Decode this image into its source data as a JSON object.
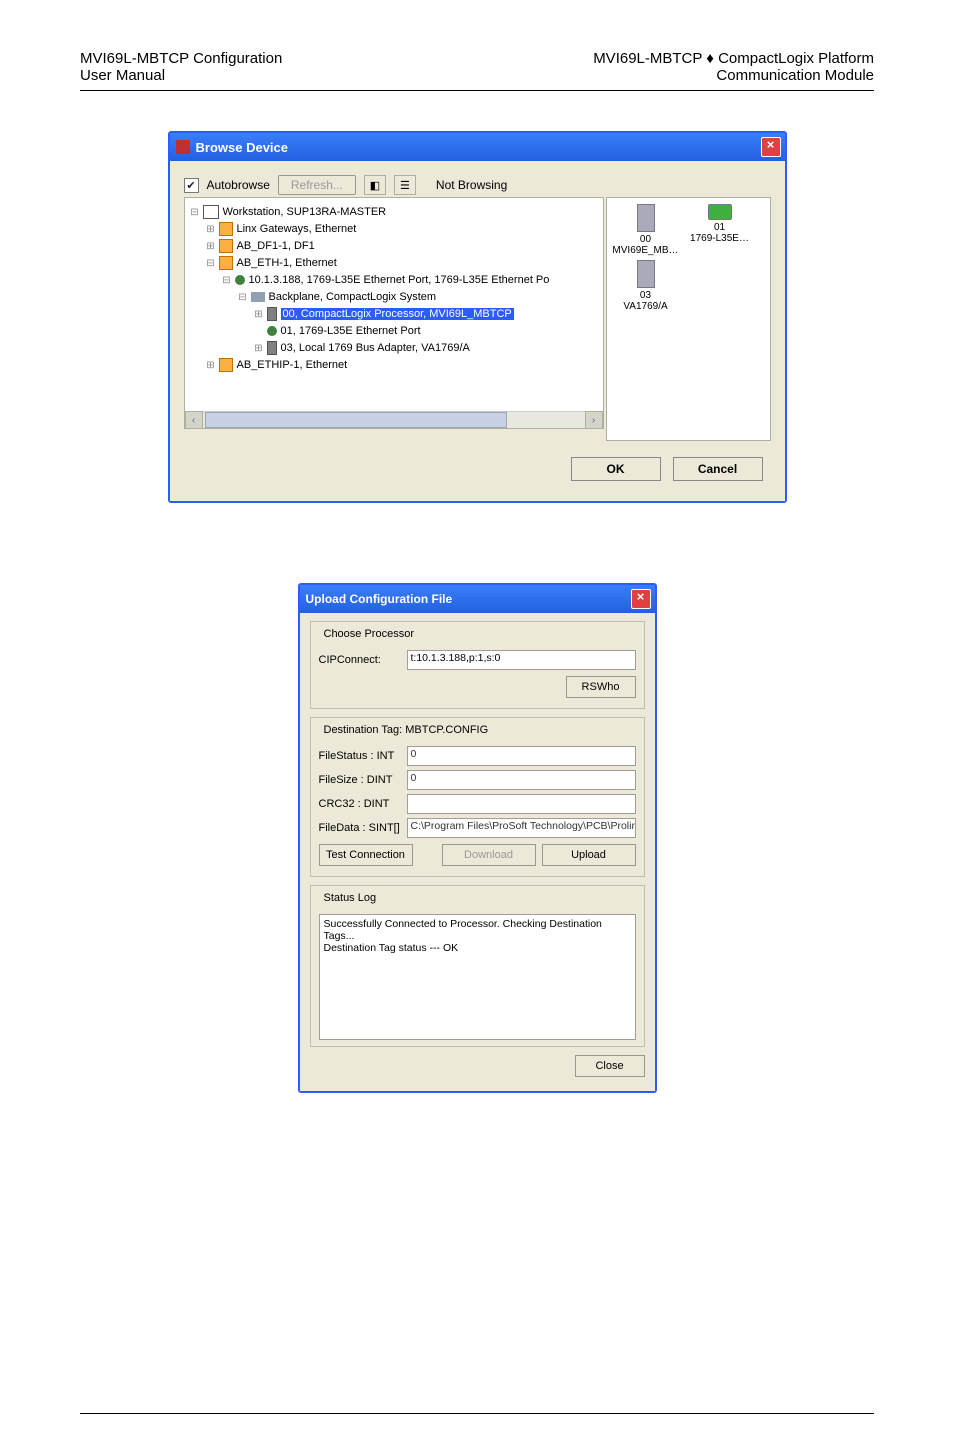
{
  "header": {
    "left_line1": "MVI69L-MBTCP Configuration",
    "left_line2": "User Manual",
    "right_line1": "MVI69L-MBTCP ♦ CompactLogix Platform",
    "right_line2": "Communication Module"
  },
  "browse": {
    "title": "Browse Device",
    "autobrowse_label": "Autobrowse",
    "refresh_label": "Refresh...",
    "status": "Not Browsing",
    "ok": "OK",
    "cancel": "Cancel",
    "tree": {
      "n0": "Workstation, SUP13RA-MASTER",
      "n1": "Linx Gateways, Ethernet",
      "n2": "AB_DF1-1, DF1",
      "n3": "AB_ETH-1, Ethernet",
      "n4": "10.1.3.188, 1769-L35E Ethernet Port, 1769-L35E Ethernet Po",
      "n5": "Backplane, CompactLogix System",
      "n6": "00, CompactLogix Processor, MVI69L_MBTCP",
      "n7": "01, 1769-L35E Ethernet Port",
      "n8": "03, Local 1769 Bus Adapter, VA1769/A",
      "n9": "AB_ETHIP-1, Ethernet"
    },
    "right": {
      "i0_top": "00",
      "i0_bot": "MVI69E_MB…",
      "i1_top": "01",
      "i1_bot": "1769-L35E…",
      "i2_top": "03",
      "i2_bot": "VA1769/A"
    }
  },
  "upload": {
    "title": "Upload Configuration File",
    "choose_legend": "Choose Processor",
    "cip_label": "CIPConnect:",
    "cip_value": "t:10.1.3.188,p:1,s:0",
    "rswho": "RSWho",
    "dest_legend": "Destination Tag: MBTCP.CONFIG",
    "fstatus_lbl": "FileStatus : INT",
    "fstatus_val": "0",
    "fsize_lbl": "FileSize    : DINT",
    "fsize_val": "0",
    "crc_lbl": "CRC32     : DINT",
    "crc_val": "",
    "fdata_lbl": "FileData  : SINT[]",
    "fdata_val": "C:\\Program Files\\ProSoft Technology\\PCB\\Prolinx.c",
    "test": "Test Connection",
    "download": "Download",
    "upload_btn": "Upload",
    "status_legend": "Status Log",
    "log_l1": "Successfully Connected to Processor. Checking Destination Tags...",
    "log_l2": "Destination Tag status --- OK",
    "close": "Close"
  }
}
